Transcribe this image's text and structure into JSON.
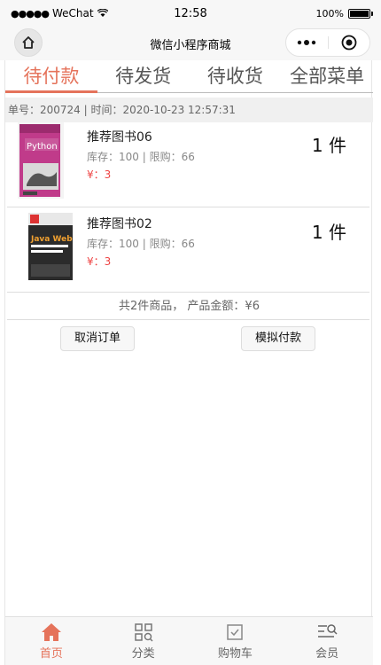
{
  "status": {
    "carrier": "WeChat",
    "time": "12:58",
    "battery": "100%"
  },
  "nav": {
    "title": "微信小程序商城"
  },
  "tabs": [
    "待付款",
    "待发货",
    "待收货",
    "全部菜单"
  ],
  "order": {
    "header": "单号：200724 | 时间：2020-10-23 12:57:31",
    "items": [
      {
        "name": "推荐图书06",
        "stock": "库存：100 | 限购：66",
        "price": "¥：3",
        "qty": "1 件",
        "cover_text": "Python"
      },
      {
        "name": "推荐图书02",
        "stock": "库存：100 | 限购：66",
        "price": "¥：3",
        "qty": "1 件",
        "cover_text": "Java Web"
      }
    ],
    "summary": "共2件商品， 产品金额：¥6",
    "cancel_label": "取消订单",
    "pay_label": "模拟付款"
  },
  "tabbar": [
    {
      "label": "首页",
      "icon": "home-icon"
    },
    {
      "label": "分类",
      "icon": "category-icon"
    },
    {
      "label": "购物车",
      "icon": "cart-icon"
    },
    {
      "label": "会员",
      "icon": "member-icon"
    }
  ],
  "colors": {
    "accent": "#e5735b",
    "price": "#e44444"
  }
}
